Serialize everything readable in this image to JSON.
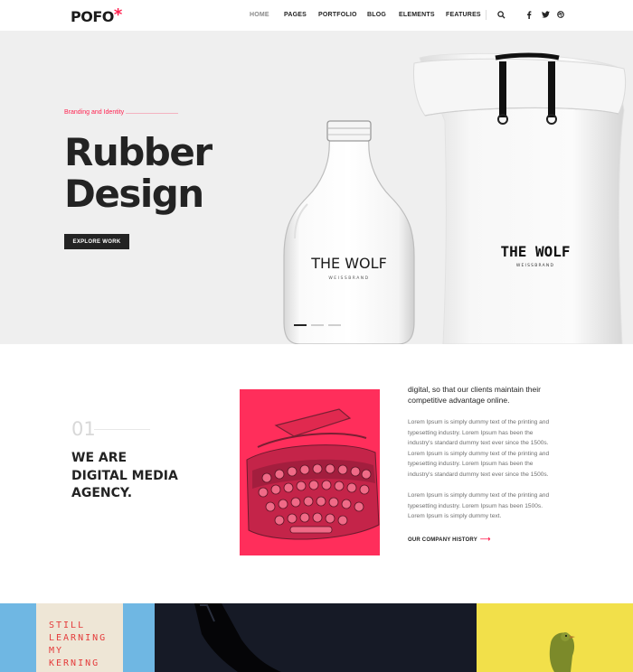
{
  "header": {
    "logo_text": "POFO",
    "logo_mark": "*",
    "nav": [
      {
        "label": "HOME",
        "active": true
      },
      {
        "label": "PAGES",
        "active": false
      },
      {
        "label": "PORTFOLIO",
        "active": false
      },
      {
        "label": "BLOG",
        "active": false
      },
      {
        "label": "ELEMENTS",
        "active": false
      },
      {
        "label": "FEATURES",
        "active": false
      }
    ],
    "icons": [
      "search-icon",
      "facebook-icon",
      "twitter-icon",
      "dribbble-icon"
    ]
  },
  "hero": {
    "eyebrow": "Branding and Identity",
    "title_line1": "Rubber",
    "title_line2": "Design",
    "button_label": "EXPLORE WORK",
    "bottle_brand": "THE WOLF",
    "bottle_sub": "WEISSBRAND",
    "bag_brand": "THE WOLF",
    "bag_sub": "WEISSBRAND",
    "slides": 3,
    "active_slide": 1
  },
  "about": {
    "number": "01",
    "heading_line1": "WE ARE",
    "heading_line2": "DIGITAL MEDIA",
    "heading_line3": "AGENCY.",
    "lead_line1": "digital, so that our clients maintain their",
    "lead_line2": "competitive advantage online.",
    "para1": [
      "Lorem Ipsum is simply dummy text of the printing and",
      "typesetting industry. Lorem Ipsum has been the",
      "industry's standard dummy text ever since the 1500s.",
      "Lorem Ipsum is simply dummy text of the printing and",
      "typesetting industry. Lorem Ipsum has been the",
      "industry's standard dummy text ever since the 1500s."
    ],
    "para2": [
      "Lorem Ipsum is simply dummy text of the printing and",
      "typesetting industry. Lorem Ipsum has been 1500s.",
      "Lorem Ipsum is simply dummy text."
    ],
    "link_label": "OUR COMPANY HISTORY",
    "link_arrow": "⟶"
  },
  "strip": {
    "tote_text": "STILL\nLEARNING\nMY\nKERNING",
    "colors": {
      "blue": "#6fb7e3",
      "navy": "#161a26",
      "yellow": "#f2e04a"
    }
  },
  "colors": {
    "accent": "#ff214f",
    "dark": "#232323",
    "hero_bg": "#efefef",
    "image_pink": "#ff2e5b"
  }
}
